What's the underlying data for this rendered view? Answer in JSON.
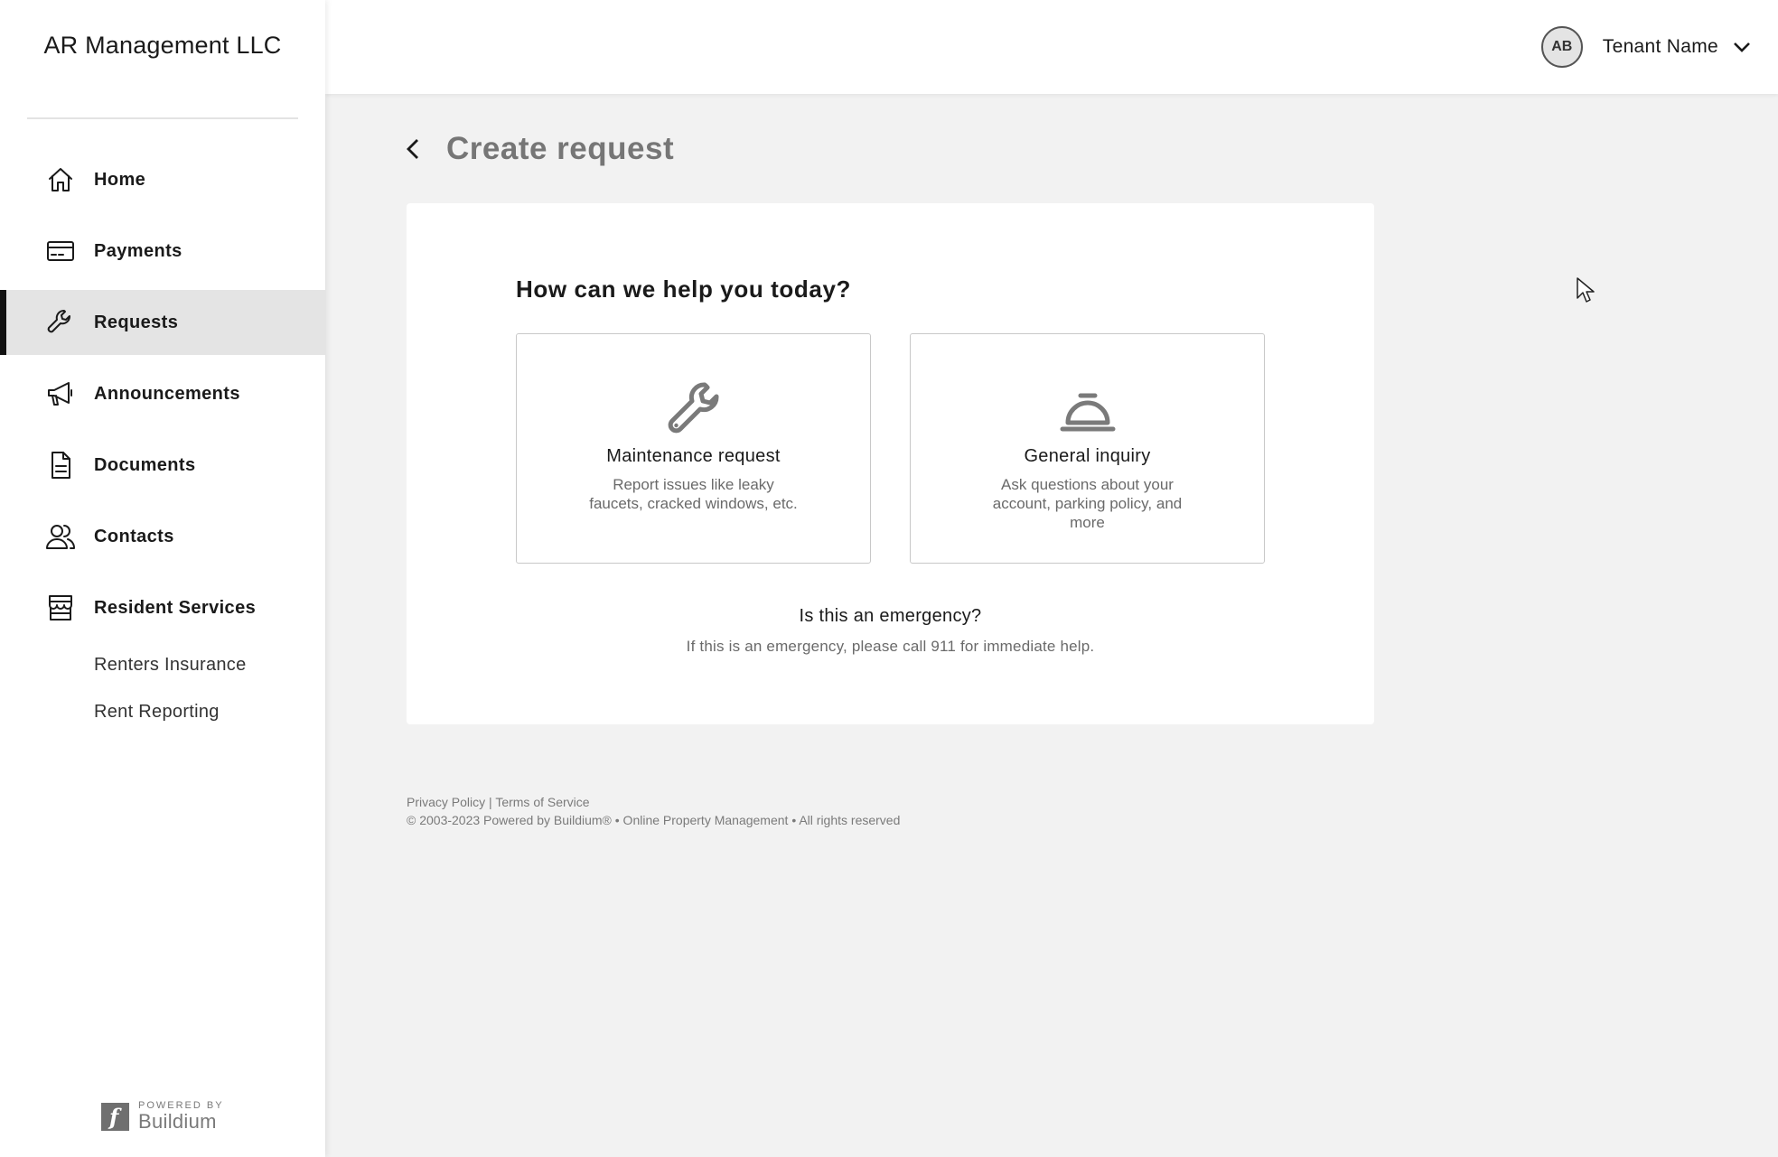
{
  "sidebar": {
    "brand": "AR Management LLC",
    "items": [
      {
        "label": "Home",
        "icon": "home-icon"
      },
      {
        "label": "Payments",
        "icon": "credit-card-icon"
      },
      {
        "label": "Requests",
        "icon": "wrench-icon",
        "active": true
      },
      {
        "label": "Announcements",
        "icon": "megaphone-icon"
      },
      {
        "label": "Documents",
        "icon": "document-icon"
      },
      {
        "label": "Contacts",
        "icon": "contacts-icon"
      },
      {
        "label": "Resident Services",
        "icon": "storefront-icon"
      }
    ],
    "sub_items": [
      "Renters Insurance",
      "Rent Reporting"
    ],
    "powered_by": {
      "small": "POWERED BY",
      "brand": "Buildium"
    }
  },
  "header": {
    "avatar_initials": "AB",
    "user_name": "Tenant Name"
  },
  "main": {
    "page_title": "Create request",
    "question": "How can we help you today?",
    "options": [
      {
        "title": "Maintenance request",
        "description": "Report issues like leaky faucets, cracked windows, etc.",
        "icon": "wrench-icon"
      },
      {
        "title": "General inquiry",
        "description": "Ask questions about your account, parking policy, and more",
        "icon": "service-bell-icon"
      }
    ],
    "emergency_title": "Is this an emergency?",
    "emergency_text": "If this is an emergency, please call 911 for immediate help."
  },
  "footer": {
    "privacy": "Privacy Policy",
    "separator": "|",
    "terms": "Terms of Service",
    "copyright": "© 2003-2023 Powered by Buildium® • Online Property Management • All rights reserved"
  },
  "colors": {
    "active_nav_bg": "#e4e4e4",
    "active_indicator": "#111111",
    "page_bg": "#f2f2f2",
    "muted_text": "#767676",
    "option_icon": "#7a7a7a"
  }
}
